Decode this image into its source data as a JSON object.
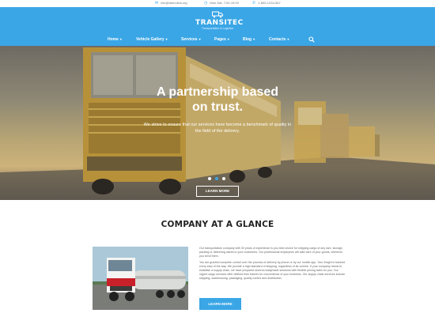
{
  "topbar": {
    "email": "info@demolink.org",
    "hours": "Mon-Sat: 7:00-19:00",
    "phone": "1-800-1234-567"
  },
  "logo": {
    "name": "TRANSITEC",
    "tagline": "Transportation & Logistics"
  },
  "nav": {
    "items": [
      {
        "label": "Home"
      },
      {
        "label": "Vehicle Gallery"
      },
      {
        "label": "Services"
      },
      {
        "label": "Pages"
      },
      {
        "label": "Blog"
      },
      {
        "label": "Contacts"
      }
    ]
  },
  "hero": {
    "title_line1": "A partnership based",
    "title_line2": "on trust.",
    "subtitle": "We strive to ensure that our services have become a benchmark of quality in the field of the delivery.",
    "button": "LEARN MORE",
    "slides": 3,
    "active_slide": 2
  },
  "company": {
    "title": "COMPANY AT A GLANCE",
    "paragraph1": "Our transportation company with 30 years of experience is you best choice for shipping cargo of any size, storage, packing or delivering wares to your customers. Our professional employees will take care of your goods, wherever you send them.",
    "paragraph2": "You are granted complete control over the process of delivery by phone or by our mobile app. Your freight is tracked every step of the way. We provide a high standard of shipping, regardless of its volume. If your company needs to establish a supply chain, we have prepared several readymade solutions with flexible pricing rates for you. Our urgent cargo services offer defined time frames for convenience of your business. Our supply chain services include shipping, warehousing, packaging, quality control and distribution.",
    "button": "LEARN MORE"
  },
  "colors": {
    "accent": "#3aa6e6",
    "heading": "#222222",
    "body_text": "#666666"
  }
}
